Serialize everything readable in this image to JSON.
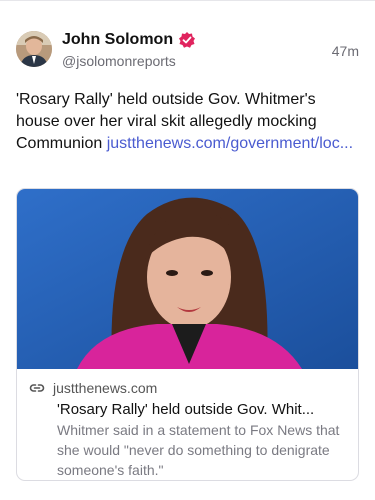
{
  "post": {
    "author": {
      "display_name": "John Solomon",
      "handle": "@jsolomonreports",
      "verified_icon": "verified-badge-icon"
    },
    "timestamp": "47m",
    "text": "'Rosary Rally' held outside Gov. Whitmer's house over her viral skit allegedly mocking Communion ",
    "link_text": "justthenews.com/government/loc..."
  },
  "link_card": {
    "domain": "justthenews.com",
    "title": "'Rosary Rally' held outside Gov. Whit...",
    "description": "Whitmer said in a statement to Fox News that she would \"never do something to denigrate someone's faith.\"",
    "link_icon": "link-icon"
  },
  "colors": {
    "accent_link": "#4a5bd0",
    "verified": "#e0245e",
    "muted_text": "#6b6b73"
  }
}
